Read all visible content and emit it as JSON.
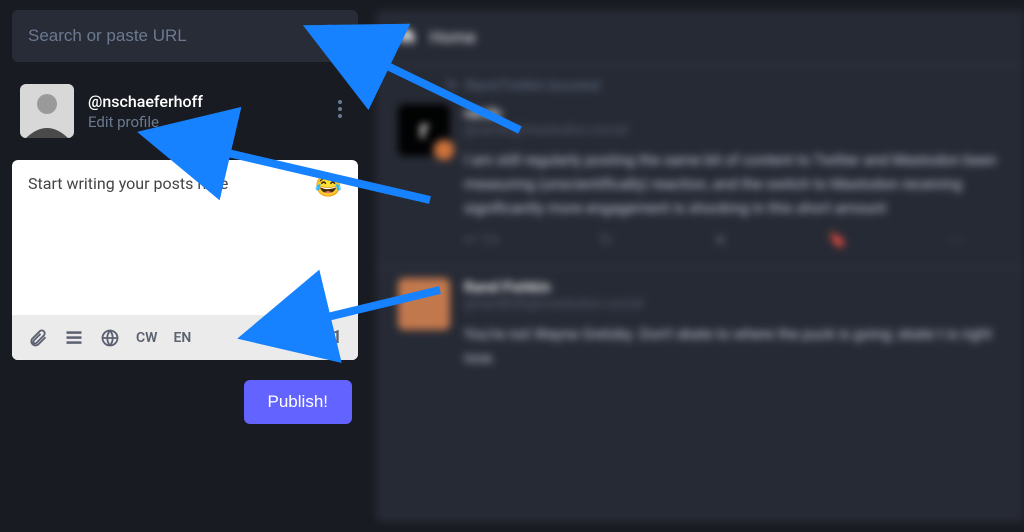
{
  "search": {
    "placeholder": "Search or paste URL"
  },
  "profile": {
    "username": "@nschaeferhoff",
    "edit_label": "Edit profile"
  },
  "compose": {
    "placeholder": "Start writing your posts here",
    "cw_label": "CW",
    "lang_label": "EN",
    "char_count": "471",
    "publish_label": "Publish!"
  },
  "timeline": {
    "header": "Home",
    "boost_text": "Rand Fishkin boosted",
    "posts": [
      {
        "avatar_letter": "r",
        "name": "rands",
        "handle": "@rands@mastodon.social",
        "content": "I am still regularly posting the same bit of content to Twitter and Mastodon been measuring (unscientifically) reaction, and the switch to Mastodon receiving significantly more engagement is shocking in this short amount",
        "reply_count": "1+"
      },
      {
        "avatar_letter": "",
        "name": "Rand Fishkin",
        "handle": "@randfish@mastodon.social",
        "content": "You're not Wayne Gretzky. Don't skate to where the puck is going; skate t is right now."
      }
    ]
  }
}
